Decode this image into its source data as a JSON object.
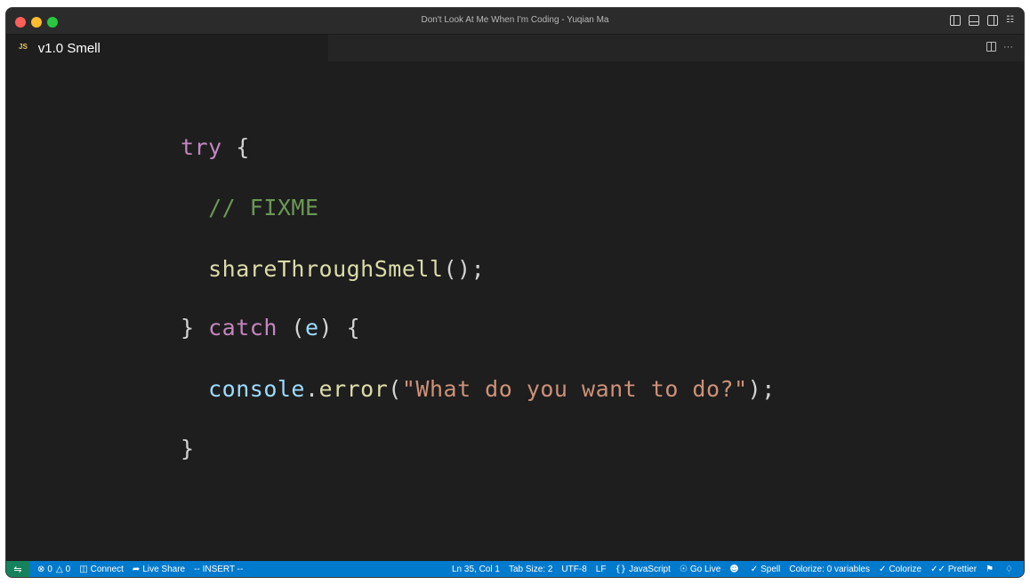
{
  "window": {
    "title": "Don't Look At Me When I'm Coding - Yuqian Ma"
  },
  "tab": {
    "badge": "JS",
    "label": "v1.0 Smell"
  },
  "code": {
    "line1": {
      "kw": "try",
      "brace": " {"
    },
    "line2": {
      "comment": "// FIXME"
    },
    "line3": {
      "fn": "shareThroughSmell",
      "rest": "();"
    },
    "line4": {
      "close": "} ",
      "kw": "catch",
      "open": " (",
      "param": "e",
      "rest": ") {"
    },
    "line5": {
      "obj": "console",
      "dot": ".",
      "method": "error",
      "open": "(",
      "str": "\"What do you want to do?\"",
      "close": ");"
    },
    "line6": {
      "close": "}"
    }
  },
  "statusbar": {
    "remote_icon": "remote-icon",
    "errors": "0",
    "warnings": "0",
    "connect": "Connect",
    "live_share": "Live Share",
    "mode": "-- INSERT --",
    "position": "Ln 35, Col 1",
    "tab_size": "Tab Size: 2",
    "encoding": "UTF-8",
    "eol": "LF",
    "language": "JavaScript",
    "go_live": "Go Live",
    "spell": "Spell",
    "colorize_vars": "Colorize: 0 variables",
    "colorize": "Colorize",
    "prettier": "Prettier"
  },
  "colors": {
    "statusbar_bg": "#007acc",
    "remote_bg": "#16825d",
    "editor_bg": "#1e1e1e",
    "keyword": "#c586c0",
    "comment": "#6a9955",
    "function": "#dcdcaa",
    "variable": "#9cdcfe",
    "string": "#ce9178"
  }
}
